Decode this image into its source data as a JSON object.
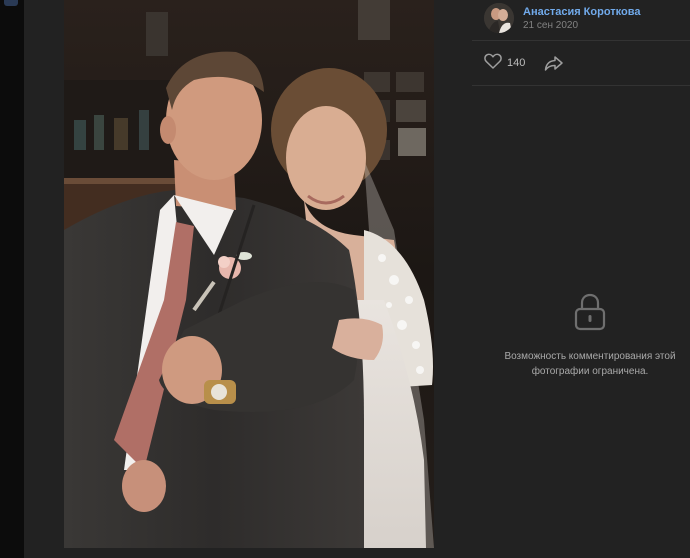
{
  "post": {
    "author_name": "Анастасия Короткова",
    "date": "21 сен 2020",
    "likes": "140"
  },
  "comments": {
    "restricted_text": "Возможность комментирования этой фотографии ограничена."
  },
  "icons": {
    "like": "heart-outline-icon",
    "share": "share-arrow-icon",
    "lock": "lock-icon"
  },
  "colors": {
    "background": "#141414",
    "panel": "#222222",
    "link": "#71aaeb",
    "muted": "#828282"
  }
}
